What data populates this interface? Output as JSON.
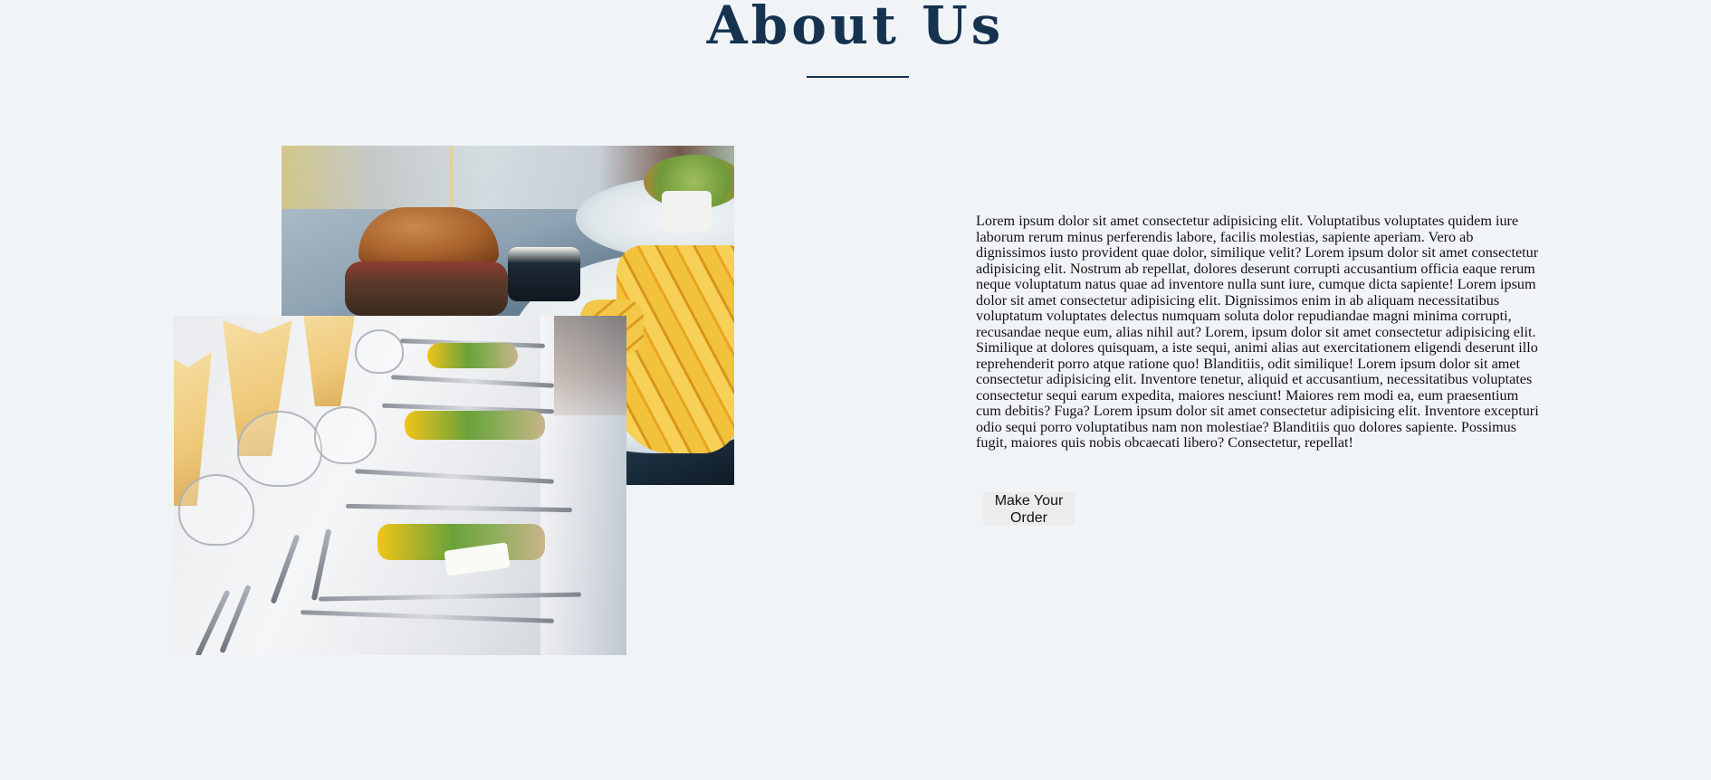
{
  "section": {
    "title": "About Us",
    "paragraph": "Lorem ipsum dolor sit amet consectetur adipisicing elit. Voluptatibus voluptates quidem iure laborum rerum minus perferendis labore, facilis molestias, sapiente aperiam. Vero ab dignissimos iusto provident quae dolor, similique velit? Lorem ipsum dolor sit amet consectetur adipisicing elit. Nostrum ab repellat, dolores deserunt corrupti accusantium officia eaque rerum neque voluptatum natus quae ad inventore nulla sunt iure, cumque dicta sapiente! Lorem ipsum dolor sit amet consectetur adipisicing elit. Dignissimos enim in ab aliquam necessitatibus voluptatum voluptates delectus numquam soluta dolor repudiandae magni minima corrupti, recusandae neque eum, alias nihil aut? Lorem, ipsum dolor sit amet consectetur adipisicing elit. Similique at dolores quisquam, a iste sequi, animi alias aut exercitationem eligendi deserunt illo reprehenderit porro atque ratione quo! Blanditiis, odit similique! Lorem ipsum dolor sit amet consectetur adipisicing elit. Inventore tenetur, aliquid et accusantium, necessitatibus voluptates consectetur sequi earum expedita, maiores nesciunt! Maiores rem modi ea, eum praesentium cum debitis? Fuga? Lorem ipsum dolor sit amet consectetur adipisicing elit. Inventore excepturi odio sequi porro voluptatibus nam non molestiae? Blanditiis quo dolores sapiente. Possimus fugit, maiores quis nobis obcaecati libero? Consectetur, repellat!",
    "button_label": "Make Your Order"
  },
  "images": {
    "back": "burger-and-fries-photo",
    "front": "table-setting-photo"
  },
  "colors": {
    "background": "#f1f4f7",
    "title": "#15324f",
    "button_bg": "#ececec"
  }
}
